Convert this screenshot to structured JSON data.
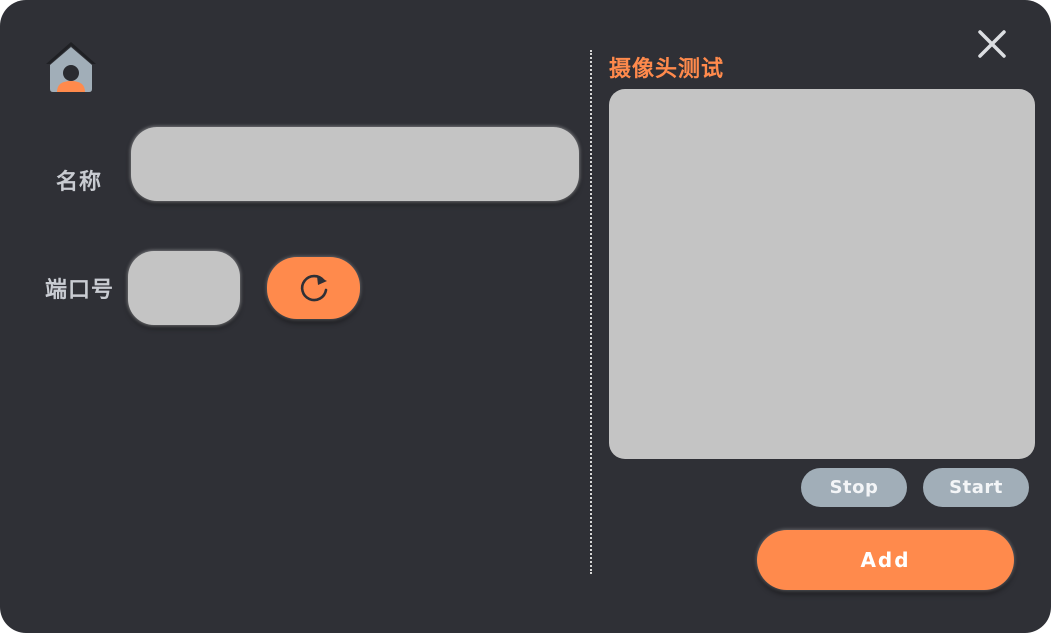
{
  "form": {
    "name_label": "名称",
    "name_value": "",
    "port_label": "端口号",
    "port_value": ""
  },
  "camera": {
    "title": "摄像头测试",
    "stop_label": "Stop",
    "start_label": "Start"
  },
  "actions": {
    "add_label": "Add"
  },
  "icons": {
    "home": "home-icon",
    "close": "close-icon",
    "refresh": "refresh-icon"
  },
  "colors": {
    "background": "#2f3036",
    "accent": "#ff8a4c",
    "input": "#c4c4c4",
    "secondary_button": "#a1aeb8",
    "label": "#c9ccd2"
  }
}
